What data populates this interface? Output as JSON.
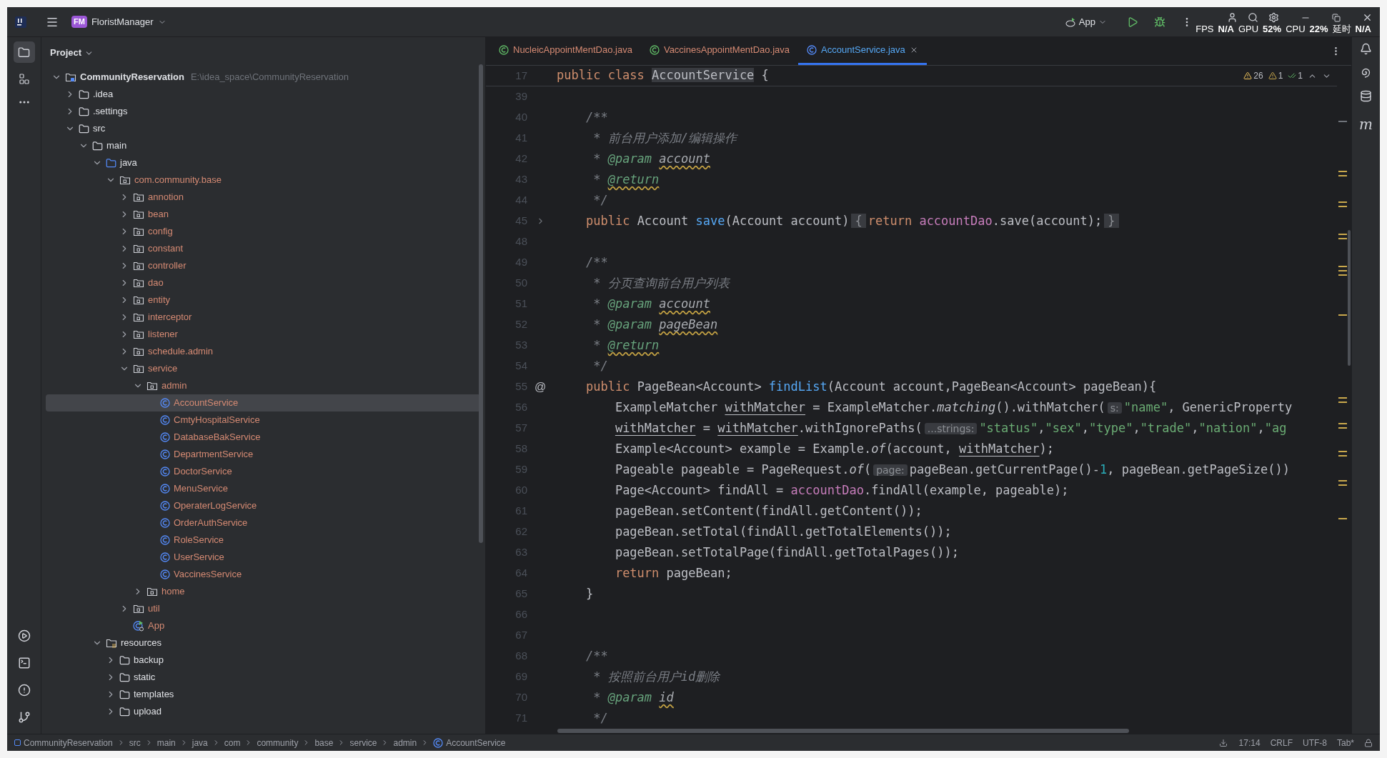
{
  "title_bar": {
    "project_badge": "FM",
    "project_name": "FloristManager",
    "run_config": "App",
    "overlay": [
      {
        "label": "FPS",
        "value": "N/A"
      },
      {
        "label": "GPU",
        "value": "52%"
      },
      {
        "label": "CPU",
        "value": "22%"
      },
      {
        "label": "延时",
        "value": "N/A"
      }
    ]
  },
  "project": {
    "title": "Project",
    "tree": [
      {
        "label": "CommunityReservation",
        "kind": "project",
        "path": "E:\\idea_space\\CommunityReservation",
        "expanded": true,
        "selected": false,
        "color": "#dfe1e5",
        "children": [
          {
            "label": ".idea",
            "kind": "folder",
            "expanded": false,
            "selected": false,
            "color": "#dfe1e5"
          },
          {
            "label": ".settings",
            "kind": "folder",
            "expanded": false,
            "selected": false,
            "color": "#dfe1e5"
          },
          {
            "label": "src",
            "kind": "folder",
            "expanded": true,
            "selected": false,
            "color": "#dfe1e5",
            "children": [
              {
                "label": "main",
                "kind": "folder",
                "expanded": true,
                "selected": false,
                "color": "#dfe1e5",
                "children": [
                  {
                    "label": "java",
                    "kind": "source_root",
                    "expanded": true,
                    "selected": false,
                    "color": "#dfe1e5",
                    "children": [
                      {
                        "label": "com.community.base",
                        "kind": "package",
                        "expanded": true,
                        "selected": false,
                        "color": "#d58a73",
                        "children": [
                          {
                            "label": "annotion",
                            "kind": "package",
                            "expanded": false,
                            "selected": false,
                            "color": "#d58a73"
                          },
                          {
                            "label": "bean",
                            "kind": "package",
                            "expanded": false,
                            "selected": false,
                            "color": "#d58a73"
                          },
                          {
                            "label": "config",
                            "kind": "package",
                            "expanded": false,
                            "selected": false,
                            "color": "#d58a73"
                          },
                          {
                            "label": "constant",
                            "kind": "package",
                            "expanded": false,
                            "selected": false,
                            "color": "#d58a73"
                          },
                          {
                            "label": "controller",
                            "kind": "package",
                            "expanded": false,
                            "selected": false,
                            "color": "#d58a73"
                          },
                          {
                            "label": "dao",
                            "kind": "package",
                            "expanded": false,
                            "selected": false,
                            "color": "#d58a73"
                          },
                          {
                            "label": "entity",
                            "kind": "package",
                            "expanded": false,
                            "selected": false,
                            "color": "#d58a73"
                          },
                          {
                            "label": "interceptor",
                            "kind": "package",
                            "expanded": false,
                            "selected": false,
                            "color": "#d58a73"
                          },
                          {
                            "label": "listener",
                            "kind": "package",
                            "expanded": false,
                            "selected": false,
                            "color": "#d58a73"
                          },
                          {
                            "label": "schedule.admin",
                            "kind": "package",
                            "expanded": false,
                            "selected": false,
                            "color": "#d58a73"
                          },
                          {
                            "label": "service",
                            "kind": "package",
                            "expanded": true,
                            "selected": false,
                            "color": "#d58a73",
                            "children": [
                              {
                                "label": "admin",
                                "kind": "package",
                                "expanded": true,
                                "selected": false,
                                "color": "#d58a73",
                                "children": [
                                  {
                                    "label": "AccountService",
                                    "kind": "class",
                                    "selected": true,
                                    "color": "#d58a73"
                                  },
                                  {
                                    "label": "CmtyHospitalService",
                                    "kind": "class",
                                    "selected": false,
                                    "color": "#d58a73"
                                  },
                                  {
                                    "label": "DatabaseBakService",
                                    "kind": "class",
                                    "selected": false,
                                    "color": "#d58a73"
                                  },
                                  {
                                    "label": "DepartmentService",
                                    "kind": "class",
                                    "selected": false,
                                    "color": "#d58a73"
                                  },
                                  {
                                    "label": "DoctorService",
                                    "kind": "class",
                                    "selected": false,
                                    "color": "#d58a73"
                                  },
                                  {
                                    "label": "MenuService",
                                    "kind": "class",
                                    "selected": false,
                                    "color": "#d58a73"
                                  },
                                  {
                                    "label": "OperaterLogService",
                                    "kind": "class",
                                    "selected": false,
                                    "color": "#d58a73"
                                  },
                                  {
                                    "label": "OrderAuthService",
                                    "kind": "class",
                                    "selected": false,
                                    "color": "#d58a73"
                                  },
                                  {
                                    "label": "RoleService",
                                    "kind": "class",
                                    "selected": false,
                                    "color": "#d58a73"
                                  },
                                  {
                                    "label": "UserService",
                                    "kind": "class",
                                    "selected": false,
                                    "color": "#d58a73"
                                  },
                                  {
                                    "label": "VaccinesService",
                                    "kind": "class",
                                    "selected": false,
                                    "color": "#d58a73"
                                  }
                                ]
                              },
                              {
                                "label": "home",
                                "kind": "package",
                                "expanded": false,
                                "selected": false,
                                "color": "#d58a73"
                              }
                            ]
                          },
                          {
                            "label": "util",
                            "kind": "package",
                            "expanded": false,
                            "selected": false,
                            "color": "#d58a73"
                          },
                          {
                            "label": "App",
                            "kind": "app_class",
                            "selected": false,
                            "color": "#d58a73"
                          }
                        ]
                      }
                    ]
                  },
                  {
                    "label": "resources",
                    "kind": "resource_root",
                    "expanded": true,
                    "selected": false,
                    "color": "#dfe1e5",
                    "children": [
                      {
                        "label": "backup",
                        "kind": "folder",
                        "expanded": false,
                        "selected": false,
                        "color": "#dfe1e5"
                      },
                      {
                        "label": "static",
                        "kind": "folder",
                        "expanded": false,
                        "selected": false,
                        "color": "#dfe1e5"
                      },
                      {
                        "label": "templates",
                        "kind": "folder",
                        "expanded": false,
                        "selected": false,
                        "color": "#dfe1e5"
                      },
                      {
                        "label": "upload",
                        "kind": "folder",
                        "expanded": false,
                        "selected": false,
                        "color": "#dfe1e5"
                      }
                    ]
                  }
                ]
              }
            ]
          }
        ]
      }
    ]
  },
  "editor": {
    "tabs": [
      {
        "label": "NucleicAppointMentDao.java",
        "kind": "interface",
        "selected": false
      },
      {
        "label": "VaccinesAppointMentDao.java",
        "kind": "interface",
        "selected": false
      },
      {
        "label": "AccountService.java",
        "kind": "class",
        "selected": true
      }
    ],
    "inspections": {
      "warnings": "26",
      "weak_warnings": "1",
      "passed": "1"
    },
    "sticky_line": {
      "number": "17",
      "tokens": [
        {
          "kind": "keyword",
          "text": "public class "
        },
        {
          "kind": "sticky_name",
          "text": "AccountService"
        },
        {
          "kind": "plain",
          "text": " {"
        }
      ]
    },
    "lines": [
      {
        "number": "39",
        "folded": false
      },
      {
        "number": "40",
        "folded": false,
        "tokens": [
          {
            "kind": "comment",
            "text": "    /**"
          }
        ]
      },
      {
        "number": "41",
        "folded": false,
        "tokens": [
          {
            "kind": "comment",
            "text": "     * 前台用户添加/编辑操作"
          }
        ]
      },
      {
        "number": "42",
        "folded": false,
        "tokens": [
          {
            "kind": "comment",
            "text": "     * "
          },
          {
            "kind": "doc_tag",
            "text": "@param"
          },
          {
            "kind": "doc_ref_warn",
            "text": " account"
          }
        ]
      },
      {
        "number": "43",
        "folded": false,
        "tokens": [
          {
            "kind": "comment",
            "text": "     * "
          },
          {
            "kind": "doc_tag_warn",
            "text": "@return"
          }
        ]
      },
      {
        "number": "44",
        "folded": false,
        "tokens": [
          {
            "kind": "comment",
            "text": "     */"
          }
        ]
      },
      {
        "number": "45",
        "folded": true,
        "tokens": [
          {
            "kind": "keyword",
            "text": "    public"
          },
          {
            "kind": "plain",
            "text": " Account "
          },
          {
            "kind": "declaration",
            "text": "save"
          },
          {
            "kind": "plain",
            "text": "(Account account)"
          },
          {
            "kind": "fold_brace",
            "text": "{"
          },
          {
            "kind": "keyword",
            "text": "return"
          },
          {
            "kind": "field",
            "text": " accountDao"
          },
          {
            "kind": "plain",
            "text": ".save(account);"
          },
          {
            "kind": "fold_brace",
            "text": "}"
          }
        ]
      },
      {
        "number": "48",
        "folded": false
      },
      {
        "number": "49",
        "folded": false,
        "tokens": [
          {
            "kind": "comment",
            "text": "    /**"
          }
        ]
      },
      {
        "number": "50",
        "folded": false,
        "tokens": [
          {
            "kind": "comment",
            "text": "     * 分页查询前台用户列表"
          }
        ]
      },
      {
        "number": "51",
        "folded": false,
        "tokens": [
          {
            "kind": "comment",
            "text": "     * "
          },
          {
            "kind": "doc_tag",
            "text": "@param"
          },
          {
            "kind": "doc_ref_warn",
            "text": " account"
          }
        ]
      },
      {
        "number": "52",
        "folded": false,
        "tokens": [
          {
            "kind": "comment",
            "text": "     * "
          },
          {
            "kind": "doc_tag",
            "text": "@param"
          },
          {
            "kind": "doc_ref_warn",
            "text": " pageBean"
          }
        ]
      },
      {
        "number": "53",
        "folded": false,
        "tokens": [
          {
            "kind": "comment",
            "text": "     * "
          },
          {
            "kind": "doc_tag_warn",
            "text": "@return"
          }
        ]
      },
      {
        "number": "54",
        "folded": false,
        "tokens": [
          {
            "kind": "comment",
            "text": "     */"
          }
        ]
      },
      {
        "number": "55",
        "folded": false,
        "gutter": "@",
        "tokens": [
          {
            "kind": "keyword",
            "text": "    public"
          },
          {
            "kind": "plain",
            "text": " PageBean<Account> "
          },
          {
            "kind": "declaration",
            "text": "findList"
          },
          {
            "kind": "plain",
            "text": "(Account account,PageBean<Account> pageBean){"
          }
        ]
      },
      {
        "number": "56",
        "folded": false,
        "tokens": [
          {
            "kind": "plain",
            "text": "        ExampleMatcher "
          },
          {
            "kind": "reassigned",
            "text": "withMatcher"
          },
          {
            "kind": "plain",
            "text": " = ExampleMatcher."
          },
          {
            "kind": "static_call",
            "text": "matching"
          },
          {
            "kind": "plain",
            "text": "().withMatcher("
          },
          {
            "kind": "hint",
            "text": "s:"
          },
          {
            "kind": "string",
            "text": "\"name\""
          },
          {
            "kind": "plain",
            "text": ", GenericProperty"
          }
        ]
      },
      {
        "number": "57",
        "folded": false,
        "tokens": [
          {
            "kind": "reassigned",
            "text": "        withMatcher"
          },
          {
            "kind": "plain",
            "text": " = "
          },
          {
            "kind": "reassigned",
            "text": "withMatcher"
          },
          {
            "kind": "plain",
            "text": ".withIgnorePaths("
          },
          {
            "kind": "hint",
            "text": "...strings:"
          },
          {
            "kind": "string",
            "text": "\"status\""
          },
          {
            "kind": "plain",
            "text": ","
          },
          {
            "kind": "string",
            "text": "\"sex\""
          },
          {
            "kind": "plain",
            "text": ","
          },
          {
            "kind": "string",
            "text": "\"type\""
          },
          {
            "kind": "plain",
            "text": ","
          },
          {
            "kind": "string",
            "text": "\"trade\""
          },
          {
            "kind": "plain",
            "text": ","
          },
          {
            "kind": "string",
            "text": "\"nation\""
          },
          {
            "kind": "plain",
            "text": ","
          },
          {
            "kind": "string",
            "text": "\"ag"
          }
        ]
      },
      {
        "number": "58",
        "folded": false,
        "tokens": [
          {
            "kind": "plain",
            "text": "        Example<Account> example = Example."
          },
          {
            "kind": "static_call",
            "text": "of"
          },
          {
            "kind": "plain",
            "text": "(account, "
          },
          {
            "kind": "reassigned",
            "text": "withMatcher"
          },
          {
            "kind": "plain",
            "text": ");"
          }
        ]
      },
      {
        "number": "59",
        "folded": false,
        "tokens": [
          {
            "kind": "plain",
            "text": "        Pageable pageable = PageRequest."
          },
          {
            "kind": "static_call",
            "text": "of"
          },
          {
            "kind": "plain",
            "text": "("
          },
          {
            "kind": "hint",
            "text": "page:"
          },
          {
            "kind": "plain",
            "text": "pageBean.getCurrentPage()-"
          },
          {
            "kind": "number",
            "text": "1"
          },
          {
            "kind": "plain",
            "text": ", pageBean.getPageSize())"
          }
        ]
      },
      {
        "number": "60",
        "folded": false,
        "tokens": [
          {
            "kind": "plain",
            "text": "        Page<Account> findAll = "
          },
          {
            "kind": "field",
            "text": "accountDao"
          },
          {
            "kind": "plain",
            "text": ".findAll(example, pageable);"
          }
        ]
      },
      {
        "number": "61",
        "folded": false,
        "tokens": [
          {
            "kind": "plain",
            "text": "        pageBean.setContent(findAll.getContent());"
          }
        ]
      },
      {
        "number": "62",
        "folded": false,
        "tokens": [
          {
            "kind": "plain",
            "text": "        pageBean.setTotal(findAll.getTotalElements());"
          }
        ]
      },
      {
        "number": "63",
        "folded": false,
        "tokens": [
          {
            "kind": "plain",
            "text": "        pageBean.setTotalPage(findAll.getTotalPages());"
          }
        ]
      },
      {
        "number": "64",
        "folded": false,
        "tokens": [
          {
            "kind": "keyword",
            "text": "        return"
          },
          {
            "kind": "plain",
            "text": " pageBean;"
          }
        ]
      },
      {
        "number": "65",
        "folded": false,
        "tokens": [
          {
            "kind": "plain",
            "text": "    }"
          }
        ]
      },
      {
        "number": "66",
        "folded": false
      },
      {
        "number": "67",
        "folded": false
      },
      {
        "number": "68",
        "folded": false,
        "tokens": [
          {
            "kind": "comment",
            "text": "    /**"
          }
        ]
      },
      {
        "number": "69",
        "folded": false,
        "tokens": [
          {
            "kind": "comment",
            "text": "     * 按照前台用户id删除"
          }
        ]
      },
      {
        "number": "70",
        "folded": false,
        "tokens": [
          {
            "kind": "comment",
            "text": "     * "
          },
          {
            "kind": "doc_tag",
            "text": "@param"
          },
          {
            "kind": "doc_ref_warn",
            "text": " id"
          }
        ]
      },
      {
        "number": "71",
        "folded": false,
        "tokens": [
          {
            "kind": "comment",
            "text": "     */"
          }
        ]
      }
    ]
  },
  "right_toolbar": {
    "maven_glyph": "m"
  },
  "status_bar": {
    "breadcrumbs": [
      {
        "label": "CommunityReservation",
        "kind": "module"
      },
      {
        "label": "src",
        "kind": "folder"
      },
      {
        "label": "main",
        "kind": "folder"
      },
      {
        "label": "java",
        "kind": "folder"
      },
      {
        "label": "com",
        "kind": "folder"
      },
      {
        "label": "community",
        "kind": "folder"
      },
      {
        "label": "base",
        "kind": "folder"
      },
      {
        "label": "service",
        "kind": "folder"
      },
      {
        "label": "admin",
        "kind": "folder"
      },
      {
        "label": "AccountService",
        "kind": "class"
      }
    ],
    "position": "17:14",
    "line_separator": "CRLF",
    "encoding": "UTF-8",
    "indent": "Tab*"
  }
}
